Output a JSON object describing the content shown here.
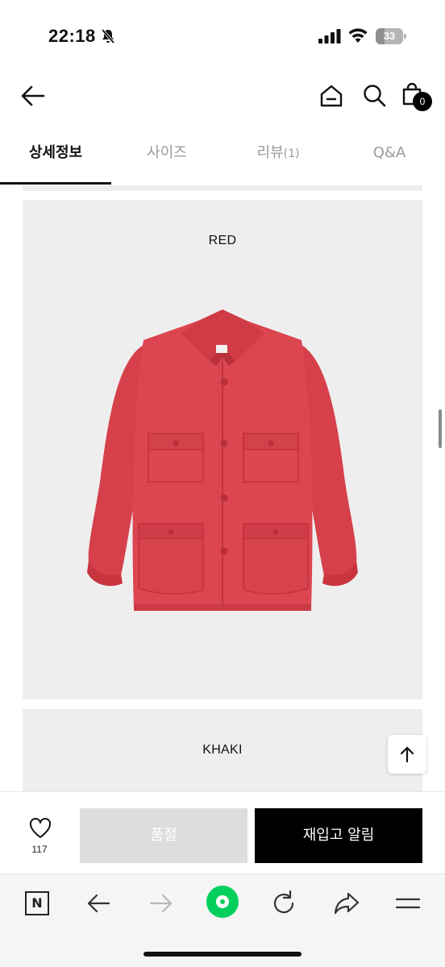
{
  "status_bar": {
    "time": "22:18",
    "battery_level": "33",
    "battery_fraction": 0.33,
    "icons": [
      "bell-off-icon",
      "signal-icon",
      "wifi-icon",
      "battery-icon"
    ]
  },
  "header": {
    "icons": [
      "arrow-left-icon",
      "home-icon",
      "search-icon",
      "shopping-bag-icon"
    ],
    "cart_count": "0"
  },
  "tabs": [
    {
      "label": "상세정보",
      "count": "",
      "active": true
    },
    {
      "label": "사이즈",
      "count": "",
      "active": false
    },
    {
      "label": "리뷰",
      "count": "(1)",
      "active": false
    },
    {
      "label": "Q&A",
      "count": "",
      "active": false
    }
  ],
  "products": [
    {
      "color_label": "RED",
      "image_color": "#dc4650"
    },
    {
      "color_label": "KHAKI"
    }
  ],
  "purchase_bar": {
    "wishlist_count": "117",
    "soldout_label": "품절",
    "restock_label": "재입고 알림"
  },
  "browser_toolbar": {
    "naver_label": "N",
    "icons": [
      "naver-icon",
      "arrow-left-icon",
      "arrow-right-icon",
      "green-circle-icon",
      "reload-icon",
      "share-icon",
      "menu-icon"
    ]
  },
  "colors": {
    "accent_green": "#03cf5d",
    "card_background": "#efeeef",
    "jacket_red": "#dc4650"
  }
}
